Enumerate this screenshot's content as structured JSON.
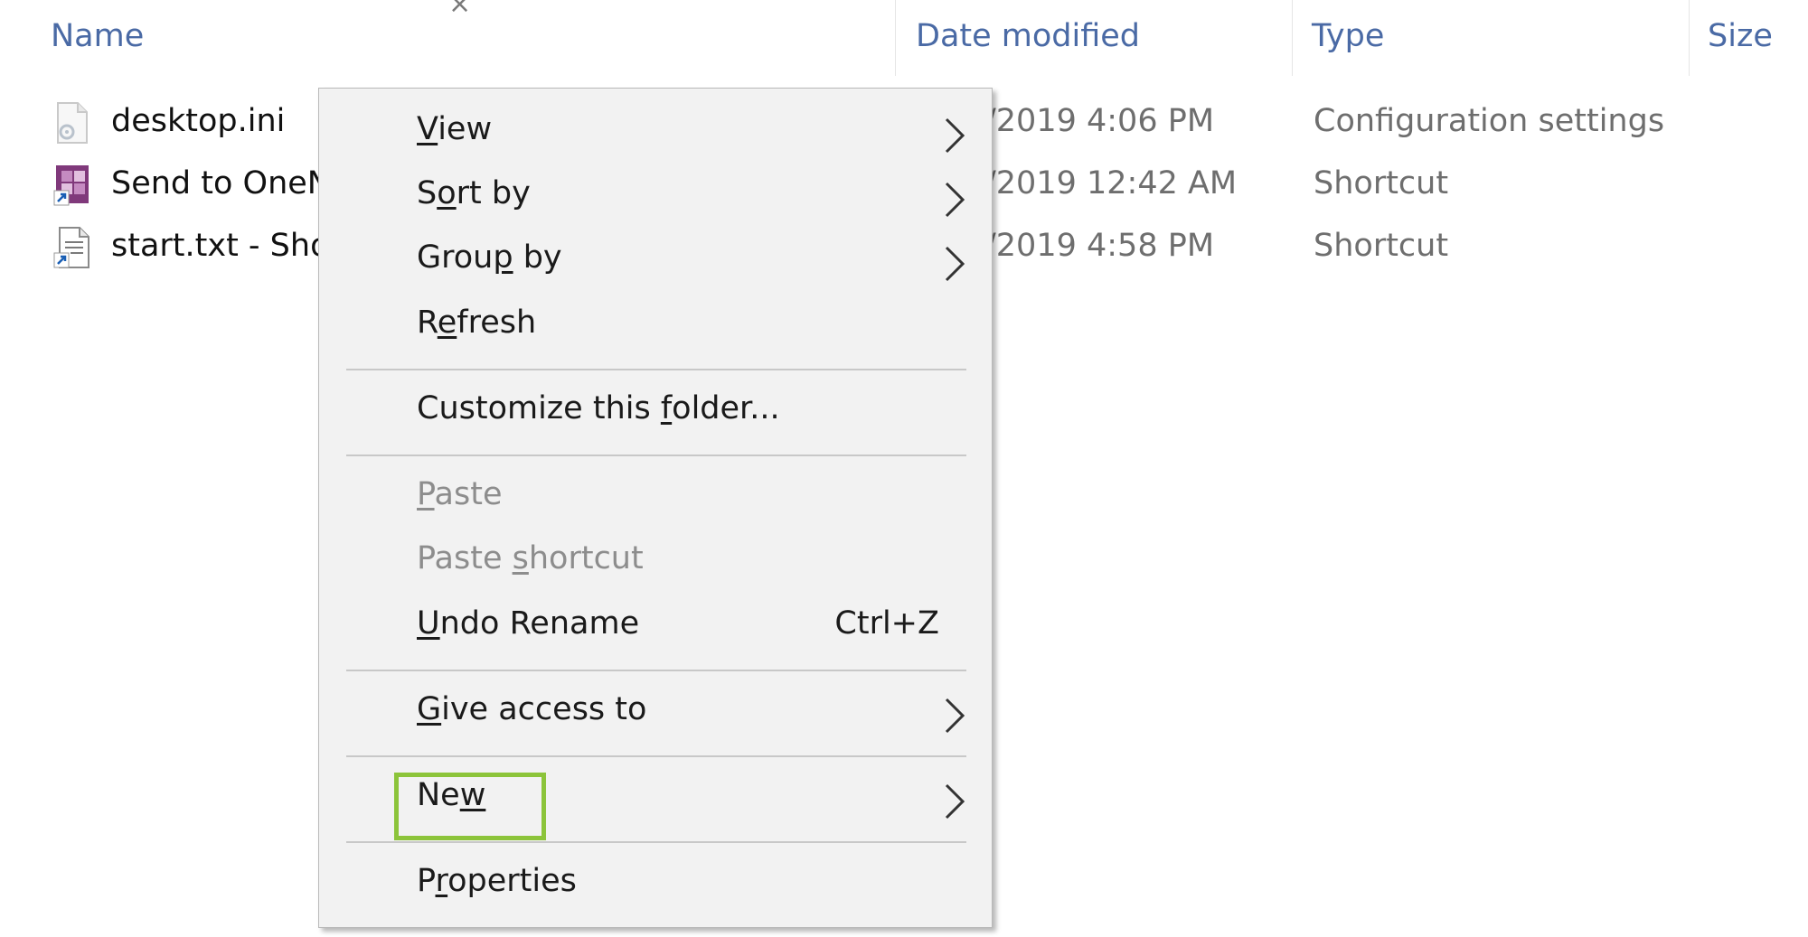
{
  "header": {
    "close_glyph": "×",
    "columns": [
      {
        "label": "Name"
      },
      {
        "label": "Date modified"
      },
      {
        "label": "Type"
      },
      {
        "label": "Size"
      }
    ]
  },
  "files": [
    {
      "name": "desktop.ini",
      "date": "/2019 4:06 PM",
      "type": "Configuration settings",
      "icon": "settings-file-icon"
    },
    {
      "name": "Send to OneN",
      "date": "/2019 12:42 AM",
      "type": "Shortcut",
      "icon": "onenote-shortcut-icon"
    },
    {
      "name": "start.txt - Sho",
      "date": "/2019 4:58 PM",
      "type": "Shortcut",
      "icon": "text-shortcut-icon"
    }
  ],
  "context_menu": {
    "items": [
      {
        "pre": "",
        "key": "V",
        "post": "iew"
      },
      {
        "pre": "S",
        "key": "o",
        "post": "rt by"
      },
      {
        "pre": "Grou",
        "key": "p",
        "post": " by"
      },
      {
        "pre": "R",
        "key": "e",
        "post": "fresh"
      },
      {
        "pre": "Customize this ",
        "key": "f",
        "post": "older..."
      },
      {
        "pre": "",
        "key": "P",
        "post": "aste"
      },
      {
        "pre": "Paste ",
        "key": "s",
        "post": "hortcut"
      },
      {
        "pre": "",
        "key": "U",
        "post": "ndo Rename",
        "shortcut": "Ctrl+Z"
      },
      {
        "pre": "",
        "key": "G",
        "post": "ive access to"
      },
      {
        "pre": "Ne",
        "key": "w",
        "post": ""
      },
      {
        "pre": "P",
        "key": "r",
        "post": "operties"
      }
    ],
    "highlight_color": "#8cc43a"
  }
}
